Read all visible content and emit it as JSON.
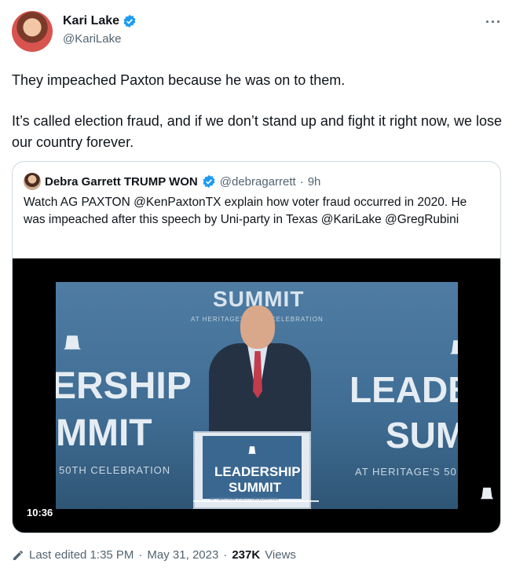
{
  "author": {
    "name": "Kari Lake",
    "handle": "@KariLake",
    "verified_color": "#1d9bf0",
    "more_icon": "more-horizontal-icon",
    "more_label": "···"
  },
  "tweet": {
    "paragraph1": "They impeached Paxton because he was on to them.",
    "paragraph2": "It’s called election fraud, and if we don’t stand up and fight it right now, we lose our country forever."
  },
  "quote": {
    "name": "Debra Garrett TRUMP WON",
    "handle": "@debragarrett",
    "separator": "·",
    "age": "9h",
    "text": "Watch AG PAXTON @KenPaxtonTX explain how voter fraud occurred in 2020. He was impeached after this speech by Uni-party in Texas @KariLake @GregRubini",
    "video": {
      "duration": "10:36",
      "frame_top": "SUMMIT",
      "frame_sub": "AT HERITAGE'S 50TH CELEBRATION",
      "frame_left1": "ERSHIP",
      "frame_left2": "MMIT",
      "frame_left3": "50TH CELEBRATION",
      "frame_right1": "LEADE",
      "frame_right2": "SUM",
      "frame_right3": "AT HERITAGE'S 50",
      "podium_line1": "LEADERSHIP",
      "podium_line2": "SUMMIT",
      "podium_line3": "AT HERITAGE'S 50TH CELEBRATION"
    }
  },
  "footer": {
    "edited": "Last edited 1:35 PM",
    "dot1": "·",
    "date": "May 31, 2023",
    "dot2": "·",
    "views_count": "237K",
    "views_label": "Views"
  }
}
